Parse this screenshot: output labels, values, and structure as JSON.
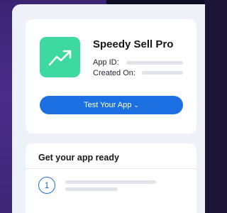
{
  "app_card": {
    "icon": "trending-up-icon",
    "icon_color": "#3ed9a0",
    "app_name": "Speedy Sell Pro",
    "app_id_label": "App ID:",
    "created_on_label": "Created On:",
    "test_button": {
      "label": "Test Your App",
      "chevron": "⌄",
      "color": "#1b6fe0"
    }
  },
  "ready_card": {
    "title": "Get your app ready",
    "steps": [
      {
        "number": "1"
      }
    ]
  }
}
